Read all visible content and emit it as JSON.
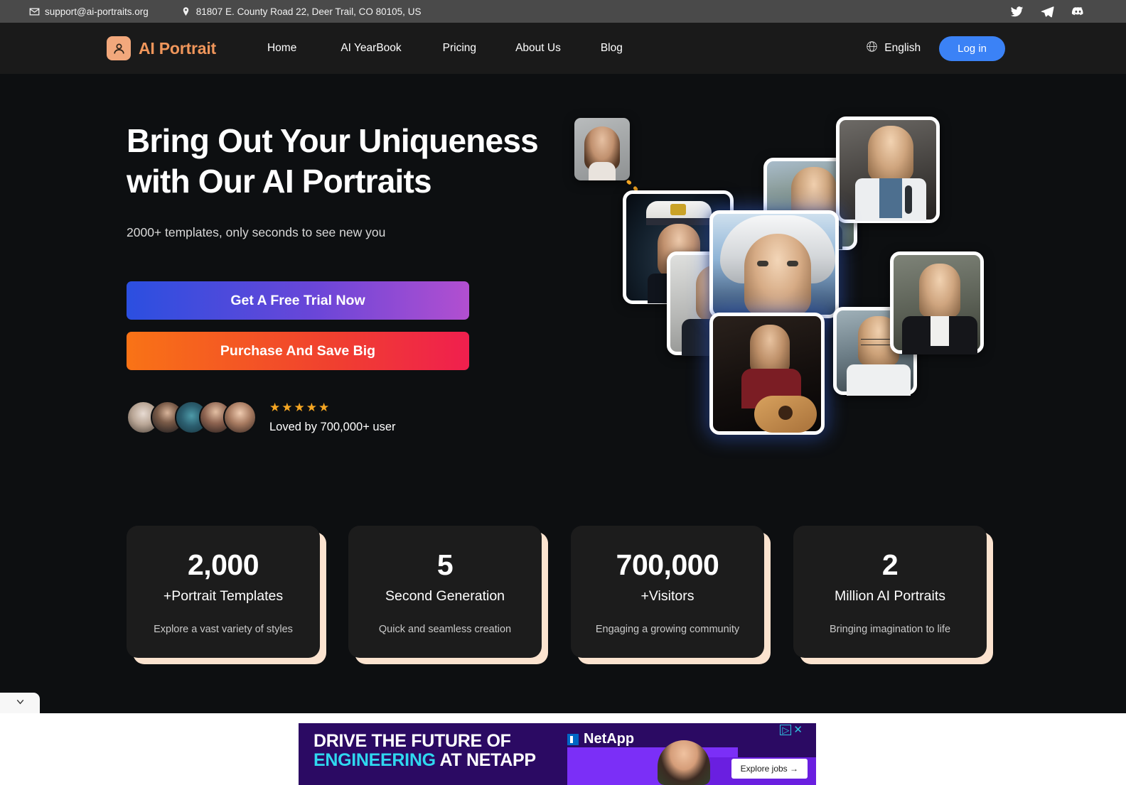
{
  "topbar": {
    "email": "support@ai-portraits.org",
    "address": "81807 E. County Road 22, Deer Trail, CO 80105, US",
    "socials": [
      "twitter-icon",
      "telegram-icon",
      "discord-icon"
    ]
  },
  "nav": {
    "brand": "AI Portrait",
    "links": [
      "Home",
      "AI YearBook",
      "Pricing",
      "About Us",
      "Blog"
    ],
    "language": "English",
    "login": "Log in"
  },
  "hero": {
    "headline_line1": "Bring Out Your Uniqueness",
    "headline_line2": "with Our AI Portraits",
    "subhead": "2000+ templates, only seconds to see new you",
    "cta_primary": "Get A Free Trial Now",
    "cta_secondary": "Purchase And Save Big",
    "stars": "★★★★★",
    "loved": "Loved by 700,000+ user"
  },
  "stats": [
    {
      "number": "2,000",
      "label": "+Portrait Templates",
      "desc": "Explore a vast variety of styles"
    },
    {
      "number": "5",
      "label": "Second Generation",
      "desc": "Quick and seamless creation"
    },
    {
      "number": "700,000",
      "label": "+Visitors",
      "desc": "Engaging a growing community"
    },
    {
      "number": "2",
      "label": "Million AI Portraits",
      "desc": "Bringing imagination to life"
    }
  ],
  "ad": {
    "line1": "DRIVE THE FUTURE OF",
    "line2_highlight": "ENGINEERING",
    "line2_rest": " AT NETAPP",
    "brand": "NetApp",
    "cta": "Explore jobs →",
    "adchoices": "▷",
    "close": "✕"
  },
  "colors": {
    "brand_orange": "#f0965b",
    "logo_tile": "#f2a87c",
    "login_blue": "#3b82f6",
    "card_shadow_cream": "#fbe3cf",
    "star_gold": "#f5a623",
    "page_bg": "#0d0f11",
    "nav_bg": "#1a1a1a",
    "topbar_bg": "#4a4a4a",
    "ad_purple": "#2b0a63",
    "ad_cyan": "#2fd8ef"
  }
}
